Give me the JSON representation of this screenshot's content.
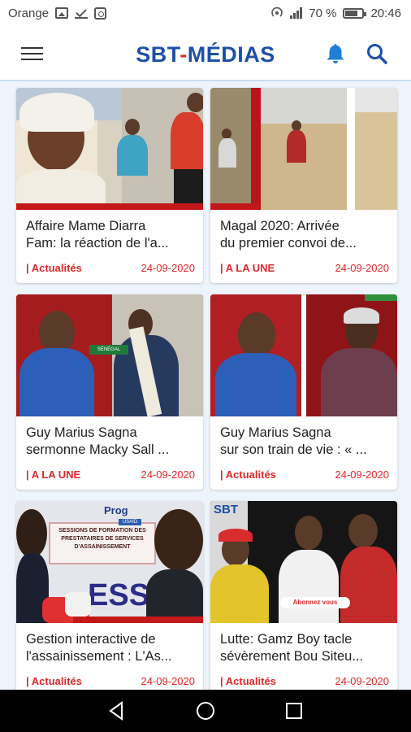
{
  "status_bar": {
    "carrier": "Orange",
    "battery": "70 %",
    "time": "20:46",
    "icons": [
      "image-icon",
      "check-icon",
      "screenshot-icon",
      "hotspot-icon",
      "signal-icon",
      "battery-icon"
    ]
  },
  "header": {
    "title_part1": "SBT",
    "title_dash": "-",
    "title_part2": "MÉDIAS",
    "accent": "#1e4fa8",
    "dash_color": "#d92c2c"
  },
  "articles": [
    {
      "title_line1": "Affaire Mame Diarra",
      "title_line2": "Fam: la réaction de l'a...",
      "category": "| Actualités",
      "date": "24-09-2020"
    },
    {
      "title_line1": "Magal 2020: Arrivée",
      "title_line2": "du premier convoi de...",
      "category": "| A LA UNE",
      "date": "24-09-2020"
    },
    {
      "title_line1": "Guy Marius Sagna",
      "title_line2": "sermonne Macky Sall ...",
      "category": "| A LA UNE",
      "date": "24-09-2020",
      "thumb_text": "SÉNÉGAL"
    },
    {
      "title_line1": "Guy Marius Sagna",
      "title_line2": "sur son train de vie : « ...",
      "category": "| Actualités",
      "date": "24-09-2020"
    },
    {
      "title_line1": "Gestion interactive de",
      "title_line2": "l'assainissement : L'As...",
      "category": "| Actualités",
      "date": "24-09-2020",
      "thumb_text": "SESSIONS DE FORMATION DES PRESTATAIRES DE SERVICES D'ASSAINISSEMENT",
      "thumb_text2": "Prog",
      "thumb_text3": "USAID"
    },
    {
      "title_line1": "Lutte: Gamz Boy tacle",
      "title_line2": "sévèrement Bou Siteu...",
      "category": "| Actualités",
      "date": "24-09-2020",
      "thumb_text": "SBT",
      "thumb_text2": "Abonnez vous"
    }
  ],
  "colors": {
    "category_red": "#e32727",
    "thumb_bar": "#c41818",
    "page_bg": "#eef4fb"
  }
}
